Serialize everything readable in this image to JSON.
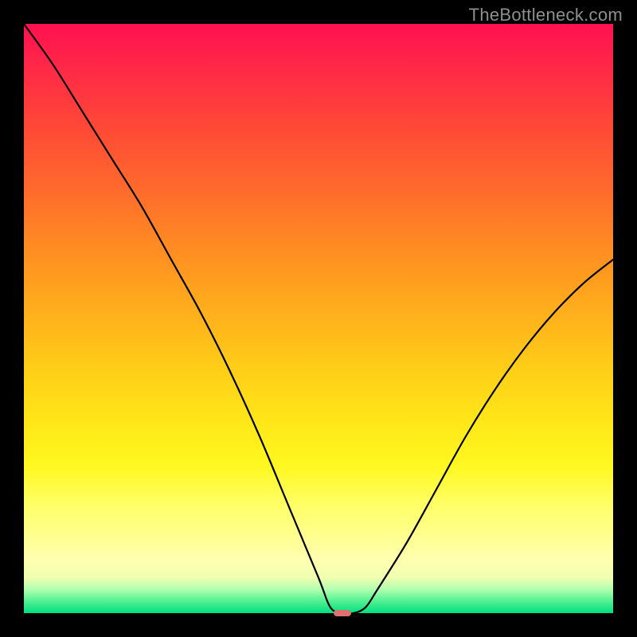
{
  "watermark": "TheBottleneck.com",
  "chart_data": {
    "type": "line",
    "title": "",
    "xlabel": "",
    "ylabel": "",
    "xlim": [
      0,
      100
    ],
    "ylim": [
      0,
      100
    ],
    "series": [
      {
        "name": "bottleneck-curve",
        "x": [
          0,
          5,
          10,
          15,
          20,
          25,
          30,
          35,
          40,
          45,
          50,
          52,
          54,
          56,
          58,
          60,
          65,
          70,
          75,
          80,
          85,
          90,
          95,
          100
        ],
        "values": [
          100,
          93,
          85,
          77,
          69,
          60,
          51,
          41,
          30,
          18,
          6,
          1,
          0,
          0,
          1,
          4,
          12,
          21,
          30,
          38,
          45,
          51,
          56,
          60
        ]
      }
    ],
    "marker": {
      "x": 54,
      "y": 0,
      "width": 3,
      "height": 1.2
    },
    "background_gradient_meaning": "red=high bottleneck, green=low bottleneck"
  }
}
